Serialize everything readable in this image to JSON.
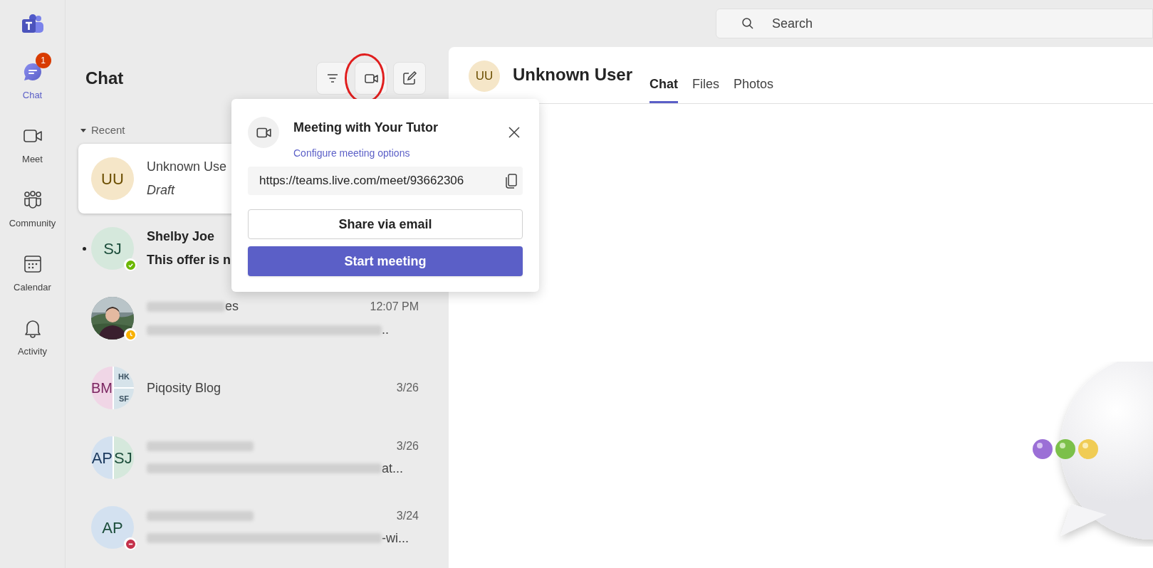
{
  "rail": [
    {
      "label": "Chat",
      "selected": true,
      "badge": "1"
    },
    {
      "label": "Meet",
      "selected": false
    },
    {
      "label": "Community",
      "selected": false
    },
    {
      "label": "Calendar",
      "selected": false
    },
    {
      "label": "Activity",
      "selected": false
    }
  ],
  "search": {
    "placeholder": "Search"
  },
  "chat_list": {
    "title": "Chat",
    "section": "Recent",
    "section_expanded": true,
    "chats": [
      {
        "avatar": {
          "kind": "initials",
          "parts": [
            {
              "text": "UU",
              "color": "#f5e6c8"
            }
          ]
        },
        "name": "Unknown Use",
        "preview": "Draft",
        "kind": "draft",
        "selected": true,
        "unread": false
      },
      {
        "avatar": {
          "kind": "initials",
          "parts": [
            {
              "text": "SJ",
              "color": "#d5e8dc"
            }
          ]
        },
        "presence": {
          "kind": "available",
          "color": "#6bb700"
        },
        "name": "Shelby Joe",
        "preview": "This offer is n",
        "selected": false,
        "unread": true
      },
      {
        "presence": {
          "kind": "away",
          "color": "#f8b100"
        },
        "name_redacted": true,
        "name": "es",
        "time": "12:07 PM",
        "preview_redacted": true,
        "preview": "..",
        "selected": false,
        "unread": false
      },
      {
        "avatar": {
          "kind": "group",
          "parts": [
            {
              "text": "BM",
              "color": "#f0d6e6"
            },
            {
              "text": "HK",
              "color": "#d6e3ea"
            },
            {
              "text": "SF",
              "color": "#d6e3ea"
            }
          ]
        },
        "name": "Piqosity Blog",
        "time": "3/26",
        "selected": false,
        "unread": false
      },
      {
        "avatar": {
          "kind": "pair",
          "parts": [
            {
              "text": "AP",
              "color": "#d3e1f0"
            },
            {
              "text": "SJ",
              "color": "#d5e8dc"
            }
          ]
        },
        "name_redacted": true,
        "time": "3/26",
        "preview_redacted": true,
        "preview": "at...",
        "selected": false,
        "unread": false
      },
      {
        "avatar": {
          "kind": "initials",
          "parts": [
            {
              "text": "AP",
              "color": "#d3e1f0"
            }
          ]
        },
        "presence": {
          "kind": "busy",
          "color": "#c4314b"
        },
        "name_redacted": true,
        "time": "3/24",
        "preview_redacted": true,
        "preview": "-wi...",
        "selected": false,
        "unread": false
      }
    ]
  },
  "meeting_popup": {
    "title": "Meeting with Your Tutor",
    "options_link": "Configure meeting options",
    "link": "https://teams.live.com/meet/93662306",
    "share_button": "Share via email",
    "start_button": "Start meeting"
  },
  "conversation": {
    "avatar": "UU",
    "name": "Unknown User",
    "tabs": [
      {
        "label": "Chat",
        "selected": true
      },
      {
        "label": "Files",
        "selected": false
      },
      {
        "label": "Photos",
        "selected": false
      }
    ]
  }
}
